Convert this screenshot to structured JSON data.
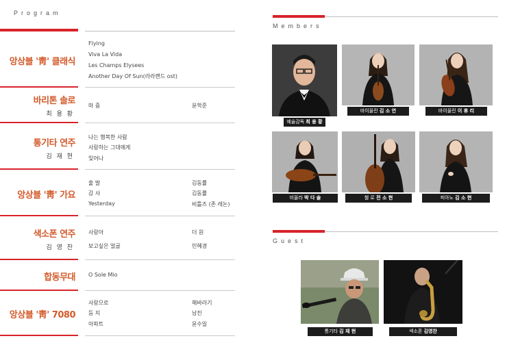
{
  "program": {
    "heading": "Program",
    "sections": [
      {
        "title": "앙상블 '靑' 클래식",
        "performer": "",
        "songs": [
          "Flying",
          "Viva La Vida",
          "Les Champs Elysees",
          "Another Day Of Sun(라라랜드 ost)"
        ],
        "composers": [
          "",
          "",
          "",
          ""
        ]
      },
      {
        "title": "바리톤 솔로",
        "performer": "최 용 황",
        "songs": [
          "마  중"
        ],
        "composers": [
          "윤학준"
        ]
      },
      {
        "title": "통기타 연주",
        "performer": "김 재 현",
        "songs": [
          "나는 행복한 사람",
          "사랑하는 그대에게",
          "잊어나"
        ],
        "composers": [
          "",
          "",
          ""
        ]
      },
      {
        "title": "앙상블 '靑' 가요",
        "performer": "",
        "songs": [
          "출  발",
          "감  사",
          "Yesterday"
        ],
        "composers": [
          "김동률",
          "김동률",
          "비틀즈 (존 레논)"
        ]
      },
      {
        "title": "색소폰 연주",
        "performer": "김 영 찬",
        "songs": [
          "사랑아",
          "보고싶은 얼굴"
        ],
        "composers": [
          "더 원",
          "민혜경"
        ]
      },
      {
        "title": "합동무대",
        "performer": "",
        "songs": [
          "O Sole Mio"
        ],
        "composers": [
          ""
        ]
      },
      {
        "title": "앙상블 '靑' 7080",
        "performer": "",
        "songs": [
          "사랑으로",
          "등  지",
          "아파트"
        ],
        "composers": [
          "해바라기",
          "남진",
          "윤수일"
        ]
      }
    ]
  },
  "members": {
    "heading": "Members",
    "people": [
      {
        "role": "예술감독",
        "name": "최 용 황"
      },
      {
        "role": "바이올린",
        "name": "김 소 연"
      },
      {
        "role": "바이올린",
        "name": "이 휴 리"
      },
      {
        "role": "비올라",
        "name": "박 다 솔"
      },
      {
        "role": "첼 로",
        "name": "전 소 현"
      },
      {
        "role": "피아노",
        "name": "김 소 현"
      }
    ]
  },
  "guest": {
    "heading": "Guest",
    "people": [
      {
        "role": "통기타",
        "name": "김 재 현"
      },
      {
        "role": "색소폰",
        "name": "김영찬"
      }
    ]
  },
  "colors": {
    "accent": "#d8232a",
    "title_orange": "#d35a2a",
    "caption_bg": "#1c1c1c"
  }
}
